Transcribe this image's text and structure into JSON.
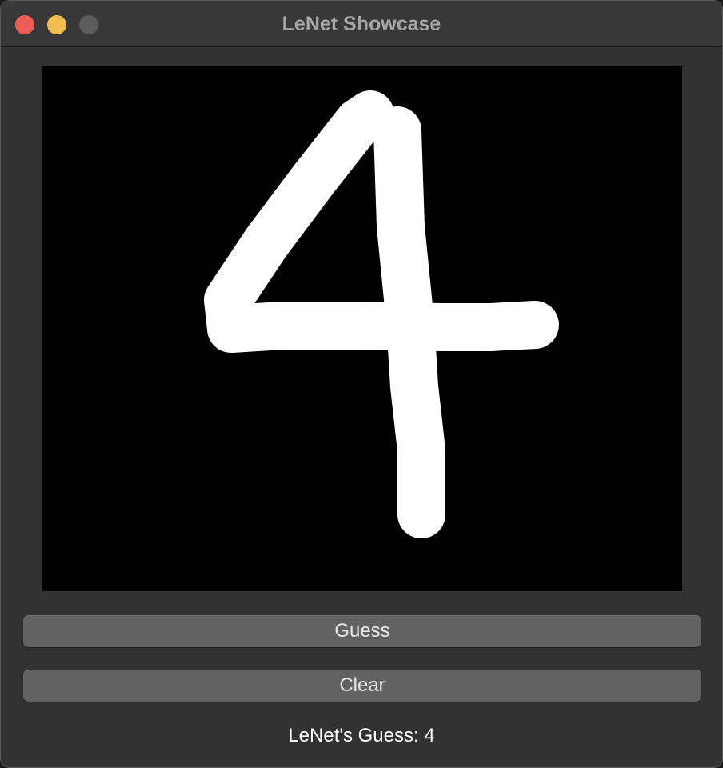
{
  "window": {
    "title": "LeNet Showcase",
    "traffic_lights": {
      "close_color": "#ec5f57",
      "minimize_color": "#f4bd4f",
      "zoom_color": "#5c5c5c"
    }
  },
  "canvas": {
    "background": "#000000",
    "stroke_color": "#ffffff",
    "drawn_digit": "4"
  },
  "buttons": {
    "guess_label": "Guess",
    "clear_label": "Clear"
  },
  "result": {
    "text": "LeNet's Guess: 4"
  }
}
